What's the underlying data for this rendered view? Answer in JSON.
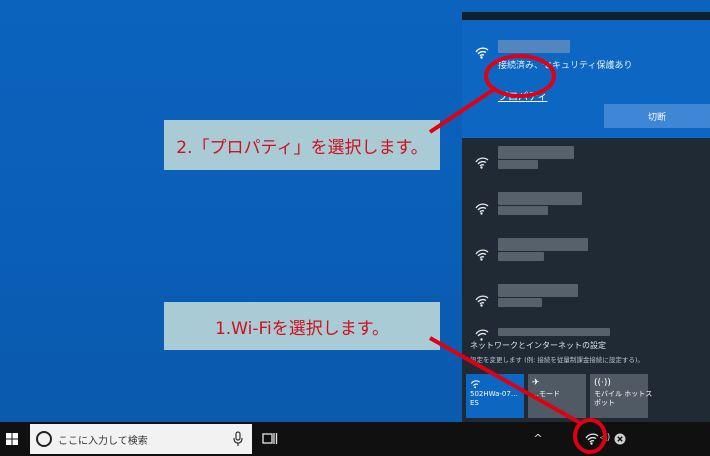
{
  "annotations": {
    "step2": "2.「プロパティ」を選択します。",
    "step1": "1.Wi-Fiを選択します。"
  },
  "wifi_panel": {
    "connected_status": "接続済み、セキュリティ保護あり",
    "properties_link": "プロパティ",
    "disconnect_button": "切断",
    "settings_link": "ネットワークとインターネットの設定",
    "settings_desc": "設定を変更します (例: 接続を従量制課金接続に設定する)。"
  },
  "quick_actions": [
    {
      "icon": "wifi-icon",
      "label": "502HWa-07…\nES"
    },
    {
      "icon": "airplane-icon",
      "label": "…モード"
    },
    {
      "icon": "hotspot-icon",
      "label": "モバイル ホットス\nポット"
    }
  ],
  "taskbar": {
    "search_placeholder": "ここに入力して検索"
  },
  "colors": {
    "desktop": "#0a5fb4",
    "flyout": "#1f2a35",
    "connected_panel": "#0c66c2",
    "callout_bg": "#a9cbd6",
    "callout_text": "#d0101a",
    "highlight": "#e00012",
    "taskbar": "#101010"
  }
}
